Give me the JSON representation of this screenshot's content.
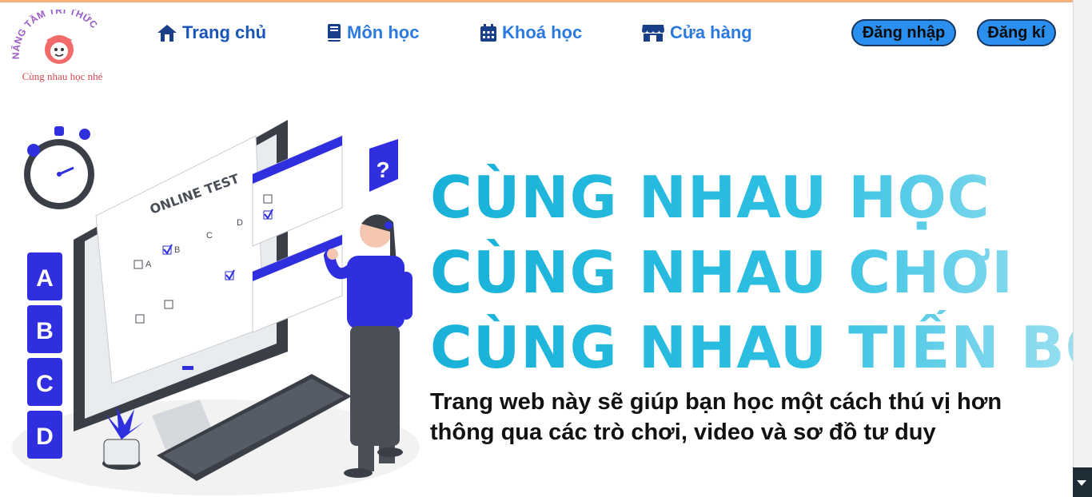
{
  "logo": {
    "arc_text": "NÂNG TẦM TRI THỨC",
    "tagline": "Cùng nhau học nhé"
  },
  "nav": {
    "items": [
      {
        "label": "Trang chủ",
        "icon": "home-icon"
      },
      {
        "label": "Môn học",
        "icon": "book-icon"
      },
      {
        "label": "Khoá học",
        "icon": "calendar-icon"
      },
      {
        "label": "Cửa hàng",
        "icon": "store-icon"
      }
    ]
  },
  "auth": {
    "login_label": "Đăng nhập",
    "register_label": "Đăng kí"
  },
  "hero": {
    "lines": [
      "CÙNG NHAU HỌC",
      "CÙNG NHAU CHƠI",
      "CÙNG NHAU TIẾN BỘ"
    ],
    "subtitle": "Trang web này sẽ giúp bạn học một cách thú vị hơn thông qua các trò chơi, video và sơ đồ tư duy"
  },
  "illustration": {
    "test_title": "ONLINE TEST",
    "answer_cards": [
      "A",
      "B",
      "C",
      "D"
    ],
    "choices": [
      "A",
      "B",
      "C",
      "D"
    ],
    "question_mark": "?"
  },
  "colors": {
    "nav_blue": "#2c7ae0",
    "button_blue": "#2b8ff0",
    "hero_cyan": "#19b1d8",
    "illustration_blue": "#2f2fe0"
  }
}
